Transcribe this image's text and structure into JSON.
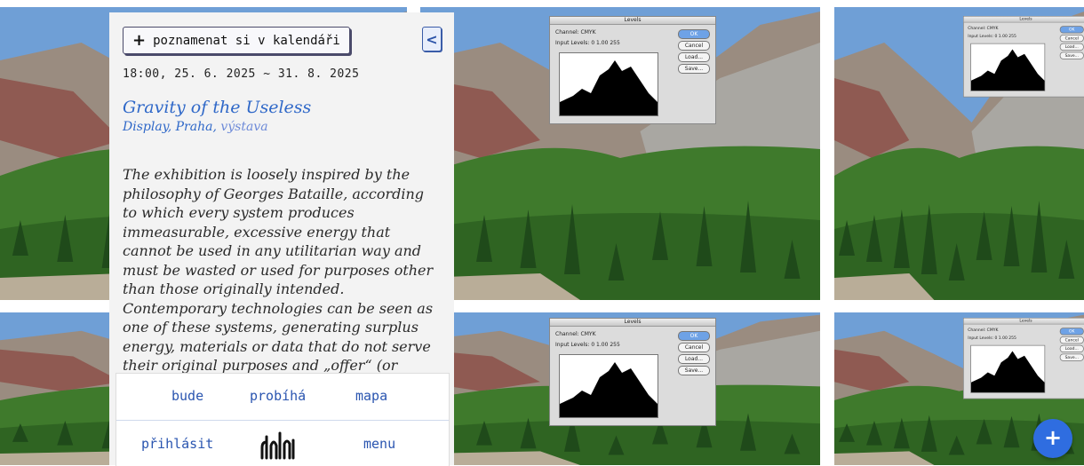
{
  "calendar_button": {
    "plus": "+",
    "label": "poznamenat si v kalendáři"
  },
  "collapse_button": {
    "glyph": "<"
  },
  "event": {
    "dates": "18:00, 25. 6. 2025 ~ 31. 8. 2025",
    "title": "Gravity of the Useless",
    "venue": "Display, Praha,",
    "kind": "výstava",
    "description": "The exhibition is loosely inspired by the philosophy of Georges Bataille, according to which every system produces immeasurable, excessive energy that cannot be used in any utilitarian way and must be wasted or used for purposes other than those originally intended. Contemporary technologies can be seen as one of these systems, generating surplus energy, materials or data that do not serve their original purposes and „offer“ (or force)"
  },
  "nav": {
    "upcoming": "bude",
    "ongoing": "probíhá",
    "map": "mapa",
    "login": "přihlásit",
    "menu": "menu"
  },
  "fab": {
    "label": "+"
  },
  "levels_dialog": {
    "title": "Levels",
    "channel_label": "Channel:",
    "channel_value": "CMYK",
    "input_label": "Input Levels:",
    "input_values": [
      "0",
      "1.00",
      "255"
    ],
    "buttons": [
      "OK",
      "Cancel",
      "Load...",
      "Save..."
    ]
  },
  "colors": {
    "accent": "#2f68c8",
    "link": "#2a55b0",
    "fab": "#2f6de0",
    "panel_bg": "#f3f3f3"
  }
}
